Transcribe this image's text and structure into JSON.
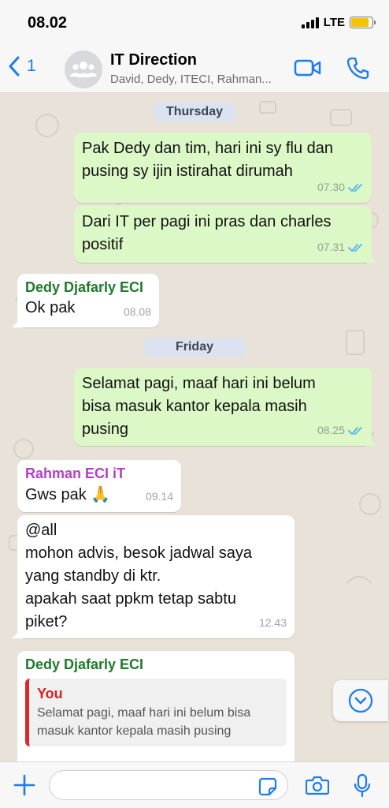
{
  "status_bar": {
    "time": "08.02",
    "network": "LTE",
    "colors": {
      "battery": "#f5c400"
    }
  },
  "header": {
    "back_count": "1",
    "title": "IT Direction",
    "subtitle": "David, Dedy, ITECI, Rahman...",
    "icons": [
      "chevron-left-icon",
      "group-avatar-icon",
      "video-call-icon",
      "phone-icon"
    ],
    "colors": {
      "accent": "#1a7cf2"
    }
  },
  "messages": {
    "date_thursday": "Thursday",
    "m1": {
      "line1": "Pak Dedy dan tim, hari ini sy flu dan",
      "line2": "pusing sy ijin istirahat dirumah",
      "time": "07.30"
    },
    "m2": {
      "line1": "Dari IT per pagi ini pras dan charles",
      "line2": "positif",
      "time": "07.31"
    },
    "m3": {
      "sender": "Dedy Djafarly ECI",
      "text": "Ok pak",
      "time": "08.08"
    },
    "date_friday": "Friday",
    "m4": {
      "line1": "Selamat pagi, maaf hari ini belum",
      "line2": "bisa masuk kantor kepala masih",
      "line3": "pusing",
      "time": "08.25"
    },
    "m5": {
      "sender": "Rahman ECI iT",
      "text": "Gws pak",
      "emoji": "🙏",
      "time": "09.14"
    },
    "m6": {
      "line1": "@all",
      "line2": "mohon advis, besok jadwal saya",
      "line3": "yang standby di ktr.",
      "line4": "apakah saat ppkm tetap sabtu",
      "line5": "piket?",
      "time": "12.43"
    },
    "m7": {
      "sender": "Dedy Djafarly ECI",
      "quote_author": "You",
      "quote_line1": "Selamat pagi, maaf hari ini belum bisa",
      "quote_line2": "masuk kantor kepala masih pusing"
    },
    "colors": {
      "outgoing_bubble": "#dcf8c6",
      "incoming_bubble": "#ffffff",
      "read_ticks": "#4fb6ec",
      "sender_dedy": "#1f7a2b",
      "sender_rahman": "#b23fc6",
      "quote_author": "#d92121"
    }
  },
  "composer": {
    "placeholder": "",
    "icons": [
      "plus-icon",
      "sticker-icon",
      "camera-icon",
      "microphone-icon"
    ]
  }
}
